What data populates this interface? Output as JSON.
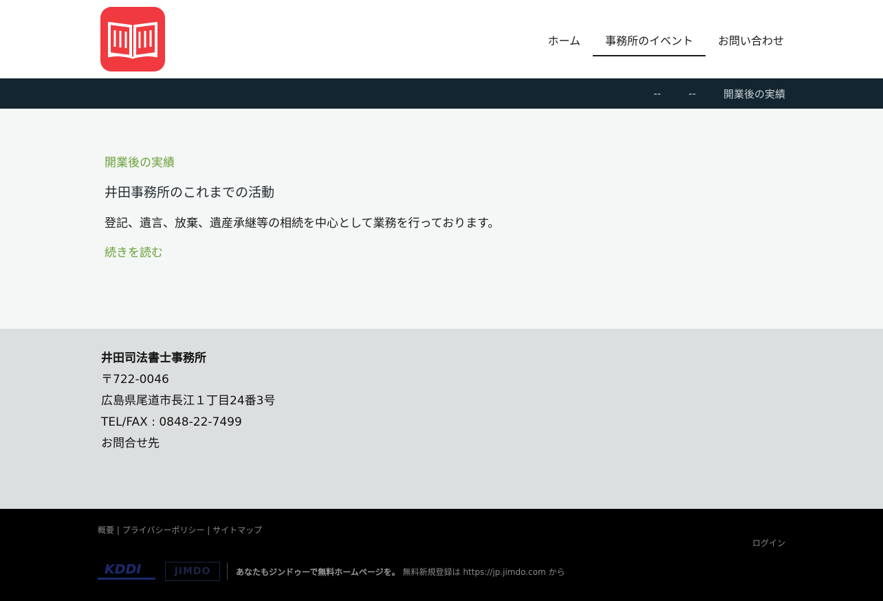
{
  "header": {
    "logo_icon": "open-book-icon",
    "brand_color": "#f03a40",
    "nav": [
      {
        "label": "ホーム",
        "active": false
      },
      {
        "label": "事務所のイベント",
        "active": true
      },
      {
        "label": "お問い合わせ",
        "active": false
      }
    ]
  },
  "subnav": {
    "items": [
      "--",
      "--",
      "開業後の実績"
    ],
    "background": "#122530"
  },
  "content": {
    "kicker": "開業後の実績",
    "title": "井田事務所のこれまでの活動",
    "text": "登記、遺言、放棄、遺産承継等の相続を中心として業務を行っております。",
    "read_more": "続きを読む",
    "accent_color": "#6aa03a"
  },
  "footer": {
    "org_name": "井田司法書士事務所",
    "postal": "〒722-0046",
    "address": "広島県尾道市長江１丁目24番3号",
    "tel": "TEL/FAX : 0848-22-7499",
    "contact_link": "お問合せ先"
  },
  "bottom": {
    "links": [
      "概要",
      "プライバシーポリシー",
      "サイトマップ"
    ],
    "separator": " | ",
    "login": "ログイン",
    "kddi_label": "KDDI",
    "jimdo_label": "JIMDO",
    "promo_bold": "あなたもジンドゥーで無料ホームページを。",
    "promo_text": "無料新規登録は https://jp.jimdo.com から"
  }
}
